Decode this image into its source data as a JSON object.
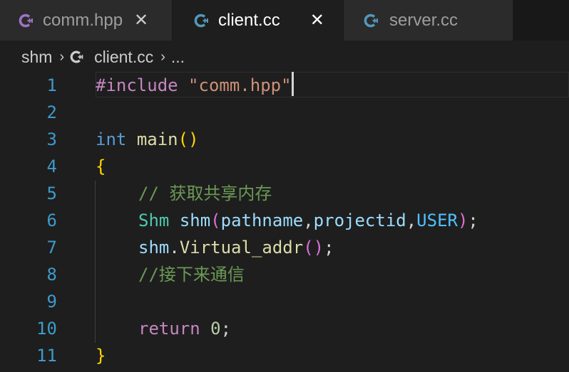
{
  "tabs": [
    {
      "label": "comm.hpp",
      "close": "✕",
      "icon": "cpp-header-icon",
      "color": "#a074c4"
    },
    {
      "label": "client.cc",
      "close": "✕",
      "icon": "cpp-file-icon",
      "color": "#519aba"
    },
    {
      "label": "server.cc",
      "icon": "cpp-file-icon",
      "color": "#519aba"
    }
  ],
  "breadcrumb": {
    "folder": "shm",
    "sep": "›",
    "file": "client.cc",
    "more": "..."
  },
  "editor": {
    "line_numbers": [
      "1",
      "2",
      "3",
      "4",
      "5",
      "6",
      "7",
      "8",
      "9",
      "10",
      "11"
    ],
    "line1": {
      "directive": "#include",
      "space": " ",
      "header": "\"comm.hpp\""
    },
    "line3": {
      "type": "int",
      "name": "main",
      "open": "(",
      "close": ")"
    },
    "line4": {
      "brace": "{"
    },
    "line5": {
      "comment": "// 获取共享内存"
    },
    "line6": {
      "cls": "Shm",
      "obj": "shm",
      "open": "(",
      "arg1": "pathname",
      "comma1": ",",
      "arg2": "projectid",
      "comma2": ",",
      "arg3": "USER",
      "close": ")",
      "semi": ";"
    },
    "line7": {
      "obj": "shm",
      "dot": ".",
      "method": "Virtual_addr",
      "open": "(",
      "close": ")",
      "semi": ";"
    },
    "line8": {
      "comment": "//接下来通信"
    },
    "line10": {
      "kw": "return",
      "num": "0",
      "semi": ";"
    },
    "line11": {
      "brace": "}"
    }
  },
  "colors": {
    "background": "#1e1e1e",
    "line_number": "#3e9acb",
    "keyword": "#569cd6",
    "string": "#ce9178",
    "function": "#dcdcaa",
    "comment": "#6a9955"
  }
}
